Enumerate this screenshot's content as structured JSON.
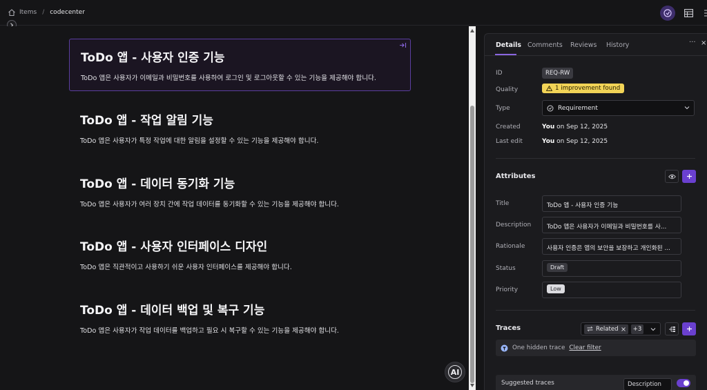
{
  "breadcrumb": {
    "root": "Items",
    "separator": "/",
    "current": "codecenter"
  },
  "requirements": [
    {
      "title": "ToDo 앱 - 사용자 인증 기능",
      "text": "ToDo 앱은 사용자가 이메일과 비밀번호를 사용하여 로그인 및 로그아웃할 수 있는 기능을 제공해야 합니다."
    },
    {
      "title": "ToDo 앱 - 작업 알림 기능",
      "text": "ToDo 앱은 사용자가 특정 작업에 대한 알림을 설정할 수 있는 기능을 제공해야 합니다."
    },
    {
      "title": "ToDo 앱 - 데이터 동기화 기능",
      "text": "ToDo 앱은 사용자가 여러 장치 간에 작업 데이터를 동기화할 수 있는 기능을 제공해야 합니다."
    },
    {
      "title": "ToDo 앱 - 사용자 인터페이스 디자인",
      "text": "ToDo 앱은 직관적이고 사용하기 쉬운 사용자 인터페이스를 제공해야 합니다."
    },
    {
      "title": "ToDo 앱 - 데이터 백업 및 복구 기능",
      "text": "ToDo 앱은 사용자가 작업 데이터를 백업하고 필요 시 복구할 수 있는 기능을 제공해야 합니다."
    }
  ],
  "ai_button": "AI",
  "panel": {
    "tabs": [
      "Details",
      "Comments",
      "Reviews",
      "History"
    ],
    "more": "···",
    "close": "×",
    "details": {
      "id_label": "ID",
      "id_value": "REQ-RW",
      "quality_label": "Quality",
      "quality_value": "1 improvement found",
      "type_label": "Type",
      "type_value": "Requirement",
      "created_label": "Created",
      "created_user": "You",
      "created_date": " on Sep 12, 2025",
      "edit_label": "Last edit",
      "edit_user": "You",
      "edit_date": " on Sep 12, 2025"
    },
    "attributes": {
      "heading": "Attributes",
      "title_label": "Title",
      "title_value": "ToDo 앱 - 사용자 인증 기능",
      "desc_label": "Description",
      "desc_value": "ToDo 앱은 사용자가 이메일과 비밀번호를 사...",
      "rationale_label": "Rationale",
      "rationale_value": "사용자 인증은 앱의 보안을 보장하고 개인화된 ...",
      "status_label": "Status",
      "status_value": "Draft",
      "priority_label": "Priority",
      "priority_value": "Low"
    },
    "traces": {
      "heading": "Traces",
      "filter_tag": "Related",
      "filter_more": "+3",
      "hidden_text": "One hidden trace",
      "clear_filter": "Clear filter",
      "suggested": "Suggested traces",
      "suggest_by": "Description"
    }
  },
  "colors": {
    "accent": "#6a40cf",
    "selected_border": "#5b3fa0",
    "quality_badge": "#f2d457"
  }
}
